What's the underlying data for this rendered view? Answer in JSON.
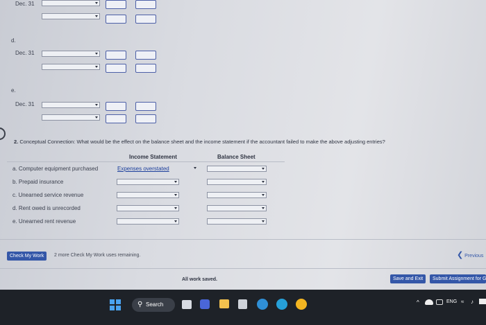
{
  "rows_top": [
    {
      "letter": "",
      "date": "Dec. 31"
    },
    {
      "letter": "d.",
      "date": "Dec. 31"
    },
    {
      "letter": "e.",
      "date": "Dec. 31"
    }
  ],
  "question": {
    "number": "2.",
    "text": "Conceptual Connection: What would be the effect on the balance sheet and the income statement if the accountant failed to make the above adjusting entries?",
    "col_income": "Income Statement",
    "col_balance": "Balance Sheet",
    "items": [
      {
        "label": "a. Computer equipment purchased",
        "income_value": "Expenses overstated"
      },
      {
        "label": "b. Prepaid insurance",
        "income_value": ""
      },
      {
        "label": "c. Unearned service revenue",
        "income_value": ""
      },
      {
        "label": "d. Rent owed is unrecorded",
        "income_value": ""
      },
      {
        "label": "e. Unearned rent revenue",
        "income_value": ""
      }
    ]
  },
  "footer": {
    "check_button": "Check My Work",
    "check_remaining": "2 more Check My Work uses remaining.",
    "previous": "Previous",
    "status": "All work saved.",
    "save_exit": "Save and Exit",
    "submit": "Submit Assignment for G"
  },
  "taskbar": {
    "search": "Search",
    "lang": "ENG"
  }
}
